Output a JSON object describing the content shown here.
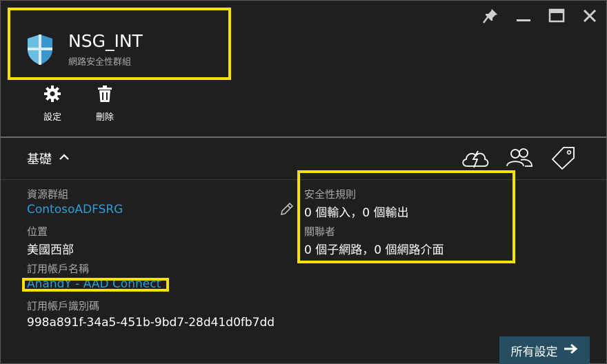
{
  "header": {
    "title": "NSG_INT",
    "subtitle": "網路安全性群組"
  },
  "toolbar": {
    "settings_label": "設定",
    "delete_label": "刪除"
  },
  "essentials": {
    "heading": "基礎",
    "resource_group_label": "資源群組",
    "resource_group_value": "ContosoADFSRG",
    "location_label": "位置",
    "location_value": "美國西部",
    "subscription_name_label": "訂用帳戶名稱",
    "subscription_name_value": "AnandY - AAD Connect",
    "subscription_id_label": "訂用帳戶識別碼",
    "subscription_id_value": "998a891f-34a5-451b-9bd7-28d41d0fb7dd",
    "security_rules_label": "安全性規則",
    "security_rules_value": "0 個輸入，0 個輸出",
    "associations_label": "關聯者",
    "associations_value": "0 個子網路，0 個網路介面"
  },
  "all_settings_label": "所有設定",
  "colors": {
    "background": "#1f1f1f",
    "link": "#2d9ed8",
    "highlight": "#f5e200",
    "button": "#264e63"
  },
  "icons": [
    "shield-icon",
    "pin-icon",
    "minimize-icon",
    "maximize-icon",
    "close-icon",
    "gear-icon",
    "trash-icon",
    "chevron-up-icon",
    "cloud-bolt-icon",
    "users-icon",
    "tag-icon",
    "pencil-icon",
    "arrow-right-icon"
  ]
}
